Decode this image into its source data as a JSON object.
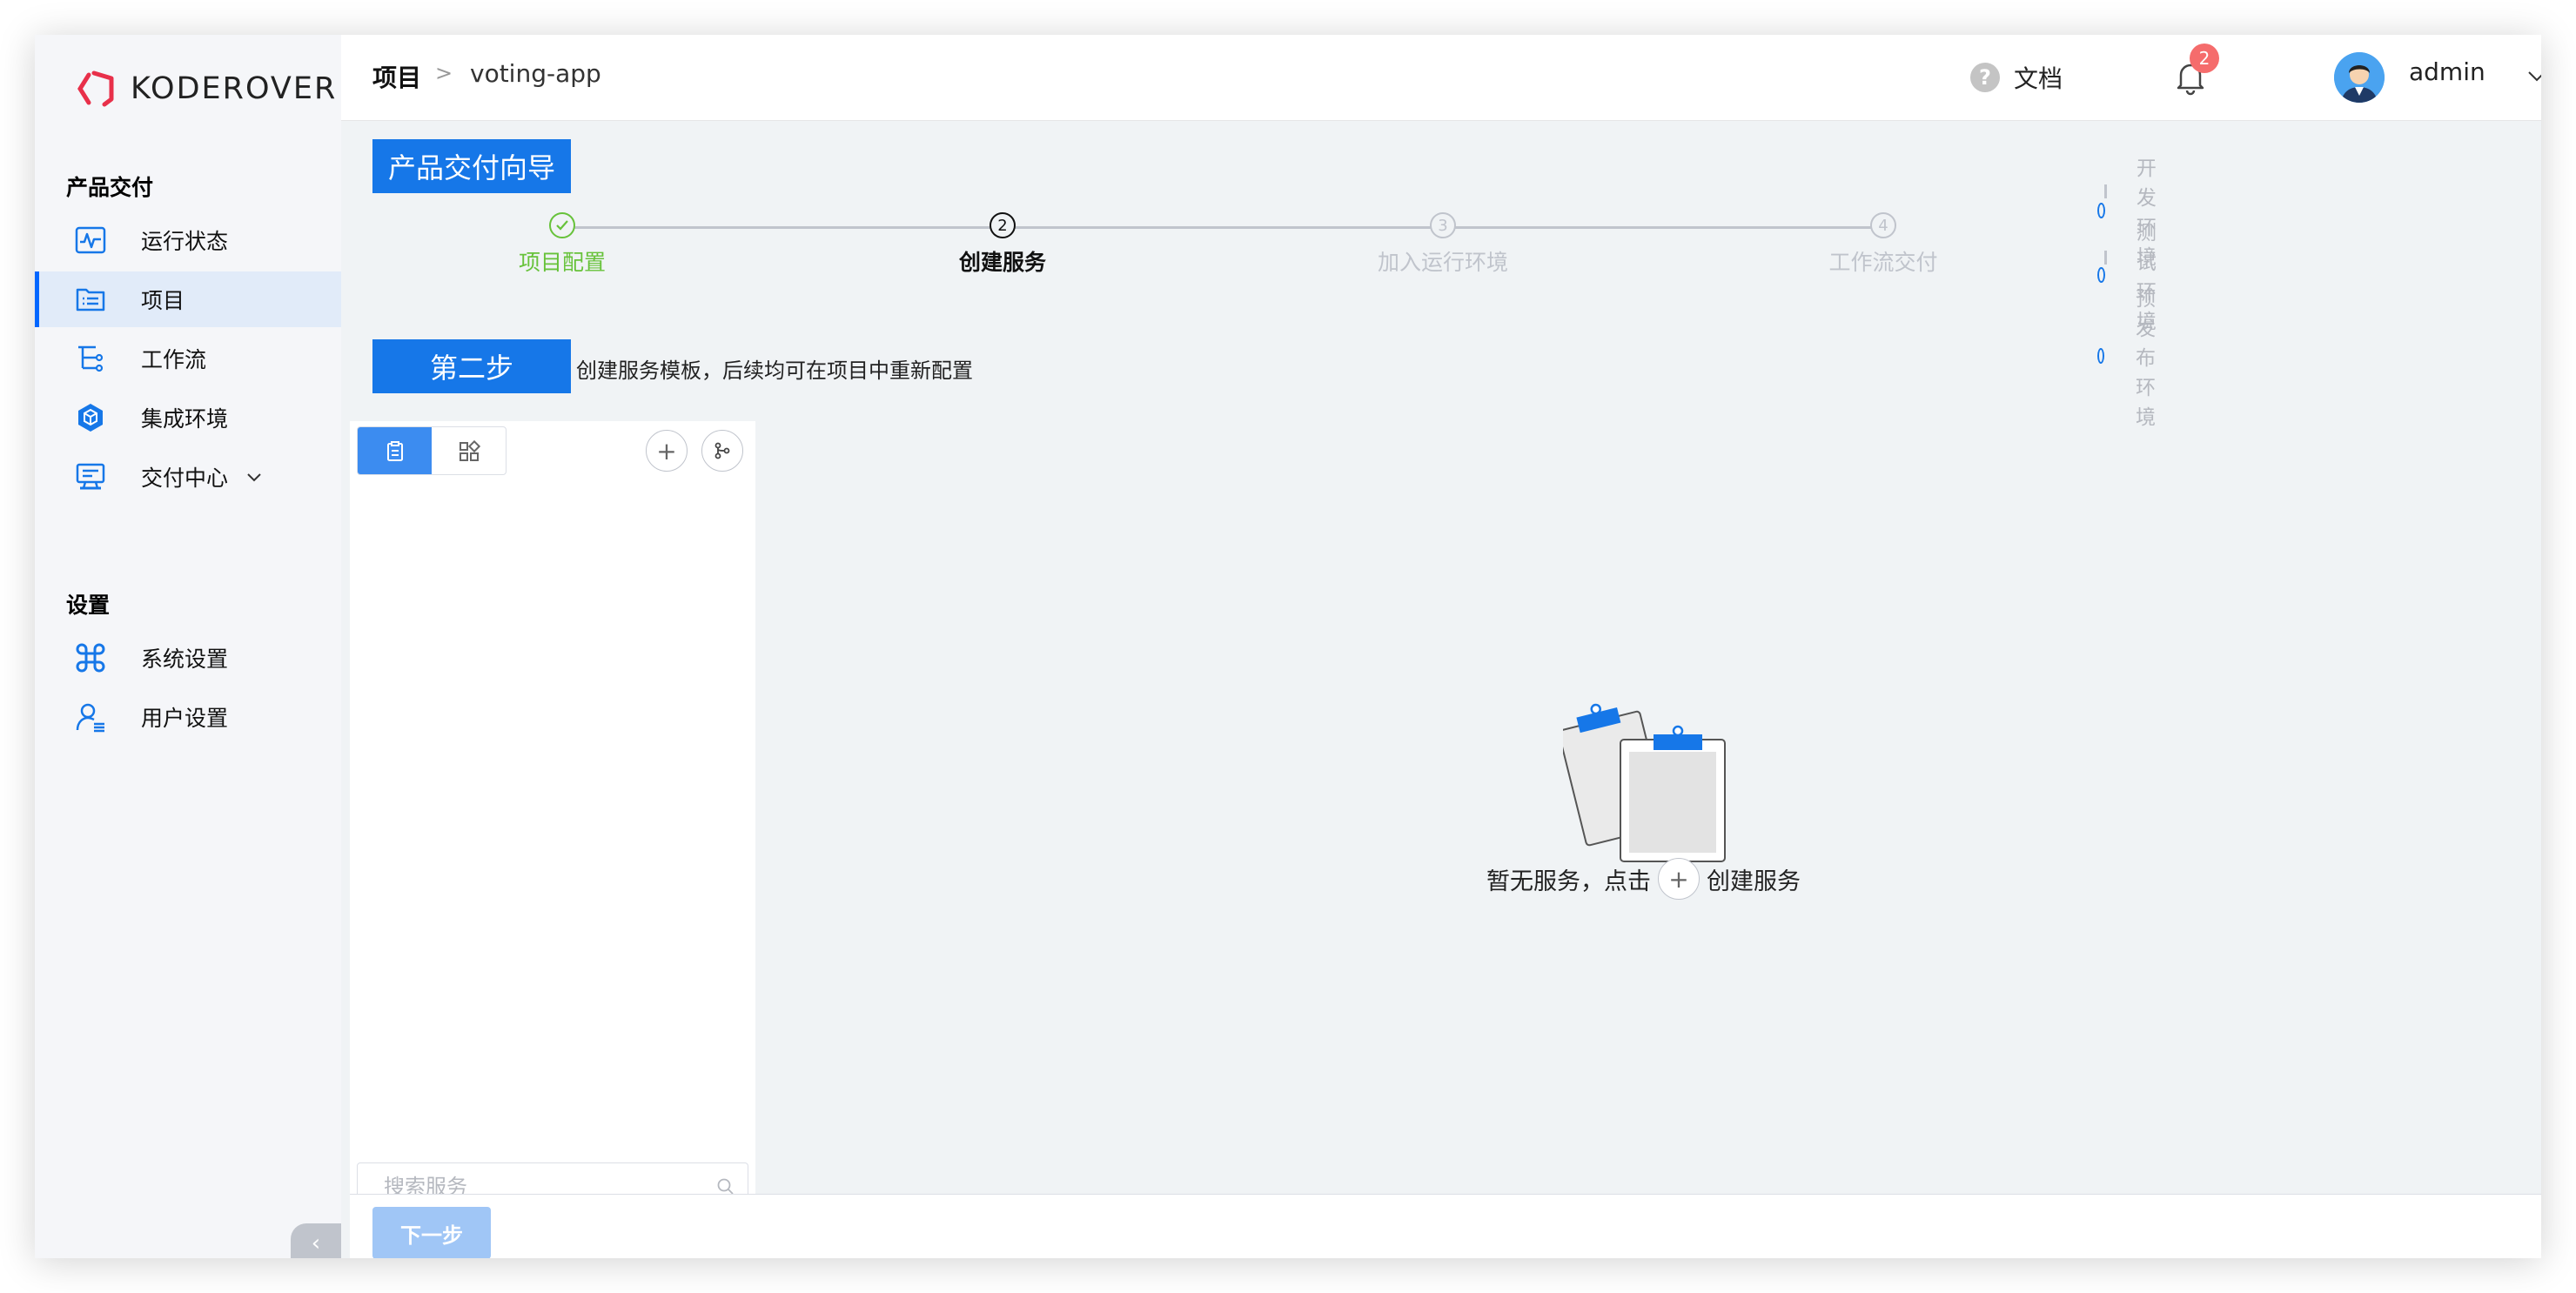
{
  "app": {
    "brand": "KodeRover",
    "brand_display": "KODEROVER"
  },
  "sidebar": {
    "section_delivery": "产品交付",
    "items_delivery": [
      {
        "label": "运行状态",
        "icon": "pulse-monitor-icon"
      },
      {
        "label": "项目",
        "icon": "project-list-icon",
        "active": true
      },
      {
        "label": "工作流",
        "icon": "workflow-tree-icon"
      },
      {
        "label": "集成环境",
        "icon": "cube-cluster-icon"
      },
      {
        "label": "交付中心",
        "icon": "delivery-screen-icon",
        "expandable": true
      }
    ],
    "section_settings": "设置",
    "items_settings": [
      {
        "label": "系统设置",
        "icon": "command-icon"
      },
      {
        "label": "用户设置",
        "icon": "user-settings-icon"
      }
    ],
    "collapse_label": "‹"
  },
  "header": {
    "breadcrumb_root": "项目",
    "breadcrumb_sep": ">",
    "breadcrumb_current": "voting-app",
    "docs_label": "文档",
    "notification_count": "2",
    "username": "admin"
  },
  "wizard": {
    "title": "产品交付向导",
    "steps": [
      {
        "num": "1",
        "label": "项目配置",
        "state": "done"
      },
      {
        "num": "2",
        "label": "创建服务",
        "state": "current"
      },
      {
        "num": "3",
        "label": "加入运行环境",
        "state": "pending"
      },
      {
        "num": "4",
        "label": "工作流交付",
        "state": "pending"
      }
    ],
    "environments": [
      "开发环境",
      "测试环境",
      "预发布环境"
    ],
    "step_tag": "第二步",
    "step_desc": "创建服务模板，后续均可在项目中重新配置"
  },
  "services": {
    "search_placeholder": "搜索服务",
    "search_value": "",
    "empty_prefix": "暂无服务，点击",
    "empty_plus": "+",
    "empty_suffix": "创建服务",
    "add_label": "+"
  },
  "footer": {
    "next_label": "下一步"
  },
  "colors": {
    "accent": "#1677e8",
    "success": "#67c23a",
    "badge": "#f56c6c",
    "sidebar_active": "#e1ebf9"
  }
}
